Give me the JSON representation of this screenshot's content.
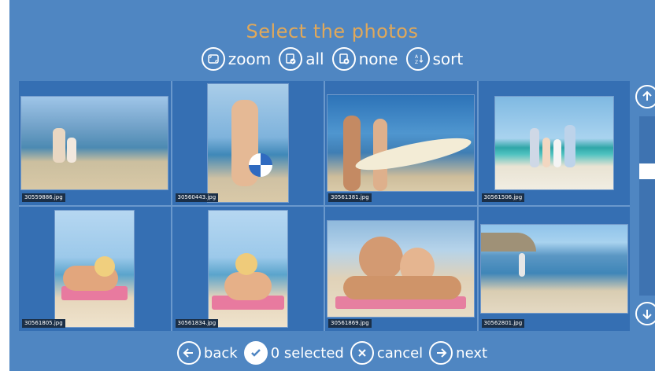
{
  "title": "Select the photos",
  "toolbar": {
    "items": [
      {
        "label": "zoom",
        "icon": "zoom-icon"
      },
      {
        "label": "all",
        "icon": "select-all-icon"
      },
      {
        "label": "none",
        "icon": "select-none-icon"
      },
      {
        "label": "sort",
        "icon": "sort-az-icon"
      }
    ]
  },
  "photos": [
    {
      "filename": "30559886.jpg"
    },
    {
      "filename": "30560443.jpg"
    },
    {
      "filename": "30561381.jpg"
    },
    {
      "filename": "30561506.jpg"
    },
    {
      "filename": "30561805.jpg"
    },
    {
      "filename": "30561834.jpg"
    },
    {
      "filename": "30561869.jpg"
    },
    {
      "filename": "30562801.jpg"
    }
  ],
  "footer": {
    "back": "back",
    "selected": "0 selected",
    "cancel": "cancel",
    "next": "next"
  },
  "colors": {
    "panel": "#4f86c2",
    "title": "#e0a85a",
    "cell": "#356fb3"
  }
}
